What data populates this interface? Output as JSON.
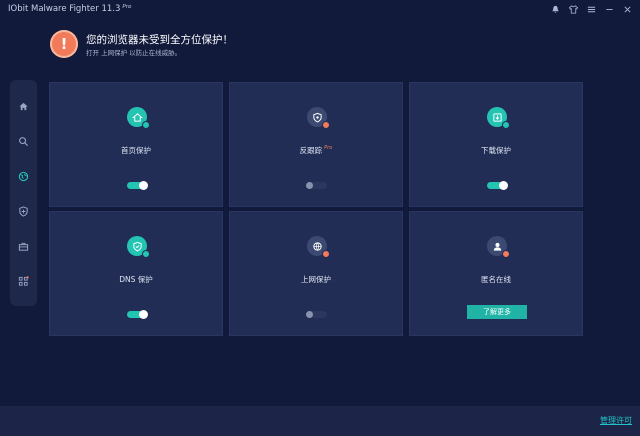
{
  "app": {
    "title": "IObit Malware Fighter 11.3",
    "edition": "Pro",
    "window_controls": [
      "bell-icon",
      "shirt-icon",
      "menu-icon",
      "minimize-icon",
      "close-icon"
    ]
  },
  "alert": {
    "icon_glyph": "!",
    "title": "您的浏览器未受到全方位保护！",
    "subtitle": "打开 上网保护 以防止在线威胁。",
    "color": "#f07a5a"
  },
  "sidebar": {
    "items": [
      {
        "icon": "home-icon",
        "active": false
      },
      {
        "icon": "search-icon",
        "active": false
      },
      {
        "icon": "globe-icon",
        "active": true
      },
      {
        "icon": "shield-plus-icon",
        "active": false
      },
      {
        "icon": "toolbox-icon",
        "active": false
      },
      {
        "icon": "apps-grid-icon",
        "active": false
      }
    ]
  },
  "tiles": [
    {
      "id": "homepage",
      "label": "首页保护",
      "icon": "home-shield-icon",
      "state": "on",
      "control": "toggle",
      "badge": "ok"
    },
    {
      "id": "antitracking",
      "label": "反跟踪",
      "pro": "Pro",
      "icon": "shield-icon",
      "state": "off",
      "control": "toggle",
      "badge": "warn"
    },
    {
      "id": "download",
      "label": "下载保护",
      "icon": "download-shield-icon",
      "state": "on",
      "control": "toggle",
      "badge": "ok"
    },
    {
      "id": "dns",
      "label": "DNS 保护",
      "icon": "dns-shield-icon",
      "state": "on",
      "control": "toggle",
      "badge": "ok"
    },
    {
      "id": "surfing",
      "label": "上网保护",
      "icon": "globe-shield-icon",
      "state": "off",
      "control": "toggle",
      "badge": "warn"
    },
    {
      "id": "anonymous",
      "label": "匿名在线",
      "icon": "user-shield-icon",
      "state": "off",
      "control": "button",
      "button_label": "了解更多",
      "badge": "warn"
    }
  ],
  "footer": {
    "license_link": "管理许可"
  },
  "colors": {
    "background": "#121a3c",
    "tile": "#222d55",
    "accent": "#24c4b3",
    "warning": "#f07a5a"
  }
}
